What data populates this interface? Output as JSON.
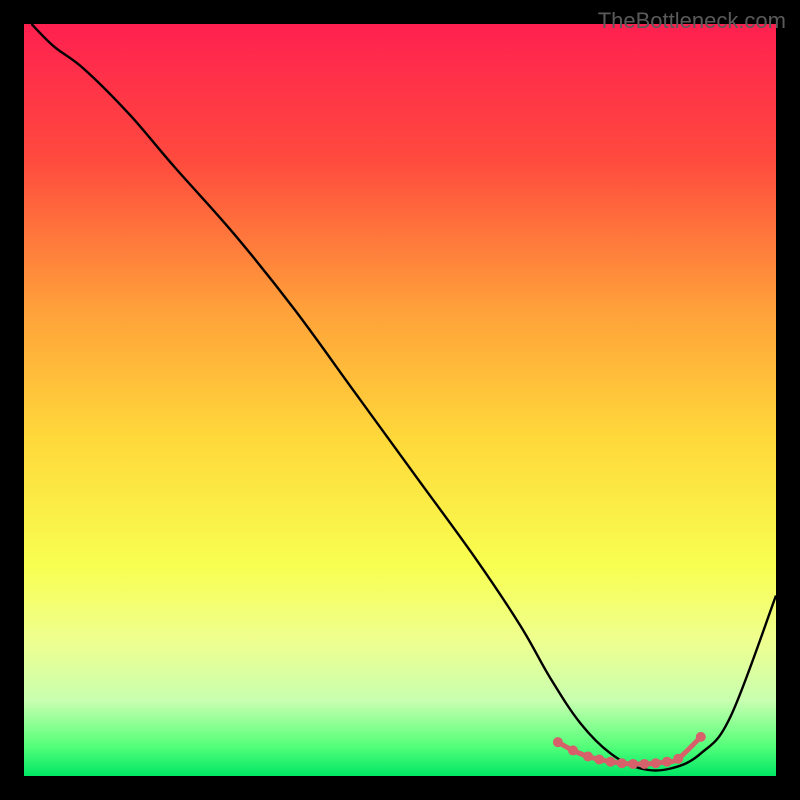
{
  "watermark": "TheBottleneck.com",
  "chart_data": {
    "type": "line",
    "title": "",
    "xlabel": "",
    "ylabel": "",
    "xlim": [
      0,
      100
    ],
    "ylim": [
      0,
      100
    ],
    "gradient_stops": [
      {
        "offset": 0,
        "color": "#ff2050"
      },
      {
        "offset": 18,
        "color": "#ff4a3e"
      },
      {
        "offset": 38,
        "color": "#ffa13a"
      },
      {
        "offset": 55,
        "color": "#ffd83a"
      },
      {
        "offset": 72,
        "color": "#f8ff50"
      },
      {
        "offset": 82,
        "color": "#efff90"
      },
      {
        "offset": 90,
        "color": "#c8ffb0"
      },
      {
        "offset": 96,
        "color": "#55ff7a"
      },
      {
        "offset": 100,
        "color": "#00e765"
      }
    ],
    "series": [
      {
        "name": "curve",
        "color": "#000000",
        "x": [
          1,
          4,
          8,
          14,
          20,
          28,
          36,
          44,
          52,
          60,
          66,
          70,
          74,
          78,
          82,
          86,
          90,
          94,
          100
        ],
        "y": [
          100,
          97,
          94,
          88,
          81,
          72,
          62,
          51,
          40,
          29,
          20,
          13,
          7,
          3,
          1,
          1,
          3,
          8,
          24
        ]
      }
    ],
    "markers": {
      "color": "#d6616b",
      "radius": 5,
      "x": [
        71,
        73,
        75,
        76.5,
        78,
        79.5,
        81,
        82.5,
        84,
        85.5,
        87,
        90
      ],
      "y": [
        4.5,
        3.4,
        2.6,
        2.2,
        1.9,
        1.7,
        1.6,
        1.6,
        1.7,
        1.9,
        2.3,
        5.2
      ]
    }
  }
}
